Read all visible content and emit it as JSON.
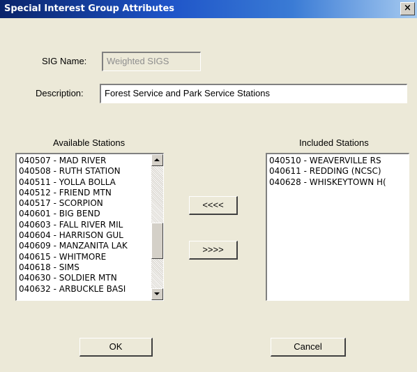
{
  "window": {
    "title": "Special Interest Group Attributes",
    "close_glyph": "×"
  },
  "form": {
    "sig_name_label": "SIG Name:",
    "sig_name_value": "Weighted SIGS",
    "description_label": "Description:",
    "description_value": "Forest Service and Park Service Stations"
  },
  "available": {
    "label": "Available Stations",
    "items": [
      "040507 - MAD RIVER",
      "040508 - RUTH STATION",
      "040511 - YOLLA BOLLA",
      "040512 - FRIEND MTN",
      "040517 - SCORPION",
      "040601 - BIG BEND",
      "040603 - FALL RIVER MIL",
      "040604 - HARRISON GUL",
      "040609 - MANZANITA LAK",
      "040615 - WHITMORE",
      "040618 - SIMS",
      "040630 - SOLDIER MTN",
      "040632 - ARBUCKLE BASI"
    ]
  },
  "included": {
    "label": "Included Stations",
    "items": [
      "040510 - WEAVERVILLE RS",
      "040611 - REDDING (NCSC)",
      "040628 - WHISKEYTOWN H("
    ]
  },
  "buttons": {
    "move_left": "<<<<",
    "move_right": ">>>>",
    "ok": "OK",
    "cancel": "Cancel"
  },
  "icons": {
    "close": "close-icon",
    "scroll_up": "scroll-up-arrow-icon",
    "scroll_down": "scroll-down-arrow-icon"
  }
}
